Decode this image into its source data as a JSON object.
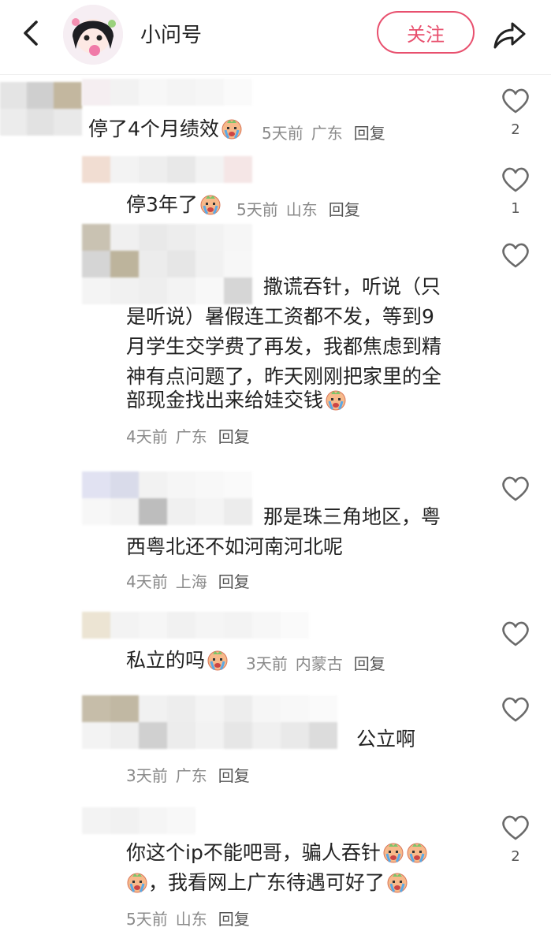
{
  "header": {
    "title": "小问号",
    "follow_label": "关注"
  },
  "comments": [
    {
      "text": "停了4个月绩效",
      "time": "5天前",
      "location": "广东",
      "reply_label": "回复",
      "likes": "2"
    },
    {
      "text": "停3年了",
      "time": "5天前",
      "location": "山东",
      "reply_label": "回复",
      "likes": "1"
    },
    {
      "text_line1": "撒谎吞针，听说（只",
      "text_line2": "是听说）暑假连工资都不发，等到9",
      "text_line3": "月学生交学费了再发，我都焦虑到精",
      "text_line4": "神有点问题了，昨天刚刚把家里的全",
      "text_line5": "部现金找出来给娃交钱",
      "time": "4天前",
      "location": "广东",
      "reply_label": "回复"
    },
    {
      "text_line1": "那是珠三角地区，粤",
      "text_line2": "西粤北还不如河南河北呢",
      "time": "4天前",
      "location": "上海",
      "reply_label": "回复"
    },
    {
      "text": "私立的吗",
      "time": "3天前",
      "location": "内蒙古",
      "reply_label": "回复"
    },
    {
      "text": "公立啊",
      "time": "3天前",
      "location": "广东",
      "reply_label": "回复"
    },
    {
      "text_line1": "你这个ip不能吧哥，骗人吞针",
      "text_line2": "，我看网上广东待遇可好了",
      "time": "5天前",
      "location": "山东",
      "reply_label": "回复",
      "likes": "2"
    }
  ],
  "colors": {
    "accent": "#e8506e",
    "meta": "#8a8a8a",
    "icon": "#6a6a6a"
  },
  "icons": {
    "back": "chevron-left-icon",
    "share": "share-arrow-icon",
    "like": "heart-outline-icon",
    "emoji": "crying-face-emoji"
  }
}
